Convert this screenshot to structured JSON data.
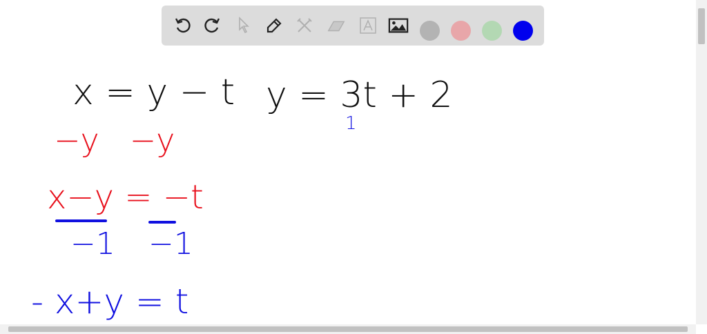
{
  "toolbar": {
    "tools": [
      "undo-icon",
      "redo-icon",
      "select-icon",
      "pen-icon",
      "tools-icon",
      "eraser-icon",
      "text-icon",
      "image-icon"
    ],
    "colors": [
      "#b3b3b3",
      "#e8a6a9",
      "#b3d8b3",
      "#0000ee"
    ]
  },
  "canvas": {
    "line1_left": "x = y − t",
    "line1_right": "y = 3t + 2",
    "mark_under_t": "1",
    "subtract": "−y   −y",
    "line2": "x−y = −t",
    "den_left": "−1",
    "den_right": "−1",
    "line3": "- x+y = t"
  }
}
